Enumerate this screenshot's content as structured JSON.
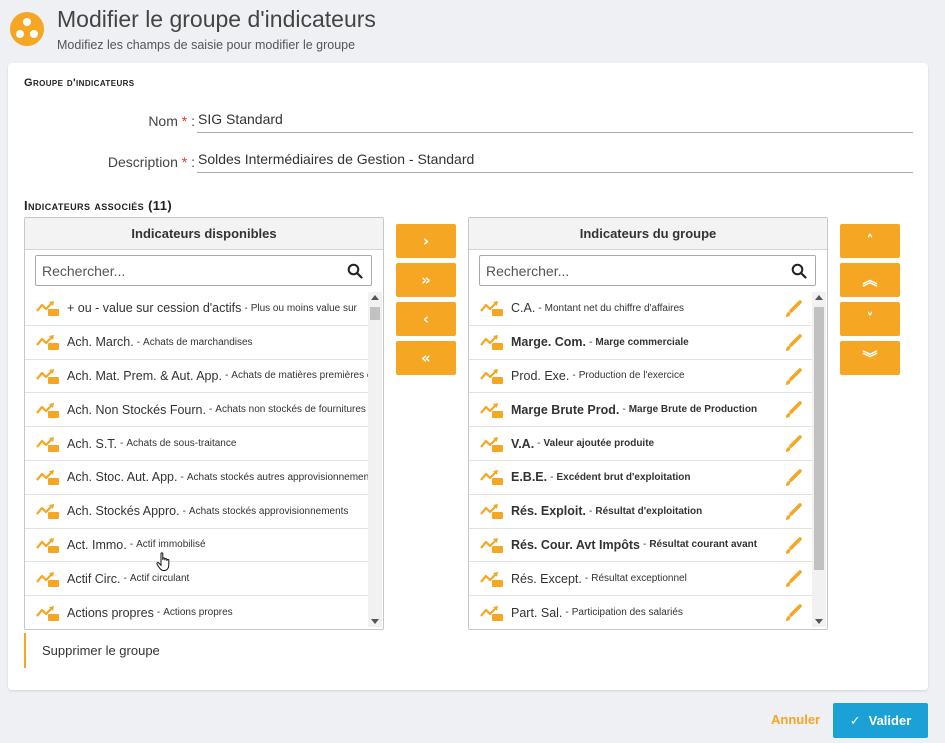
{
  "header": {
    "title": "Modifier le groupe d'indicateurs",
    "subtitle": "Modifiez les champs de saisie pour modifier le groupe",
    "logo_icon": "group-logo-icon"
  },
  "form": {
    "section_title": "Groupe d'indicateurs",
    "name_label": "Nom",
    "name_value": "SIG Standard",
    "description_label": "Description",
    "description_value": "Soldes Intermédiaires de Gestion - Standard",
    "required_mark": "*",
    "label_suffix": ":"
  },
  "associated": {
    "section_title": "Indicateurs associés (11)"
  },
  "available": {
    "header": "Indicateurs disponibles",
    "search_placeholder": "Rechercher...",
    "scroll_fraction": 0.04,
    "items": [
      {
        "code": "+ ou - value sur cession d'actifs",
        "desc": "Plus ou moins value sur"
      },
      {
        "code": "Ach. March.",
        "desc": "Achats de marchandises"
      },
      {
        "code": "Ach. Mat. Prem. & Aut. App.",
        "desc": "Achats de matières premières et"
      },
      {
        "code": "Ach. Non Stockés Fourn.",
        "desc": "Achats non stockés de fournitures"
      },
      {
        "code": "Ach. S.T.",
        "desc": "Achats de sous-traitance"
      },
      {
        "code": "Ach. Stoc. Aut. App.",
        "desc": "Achats stockés autres approvisionnements"
      },
      {
        "code": "Ach. Stockés Appro.",
        "desc": "Achats stockés approvisionnements"
      },
      {
        "code": "Act. Immo.",
        "desc": "Actif immobilisé"
      },
      {
        "code": "Actif Circ.",
        "desc": "Actif circulant"
      },
      {
        "code": "Actions propres",
        "desc": "Actions propres"
      }
    ]
  },
  "group": {
    "header": "Indicateurs du groupe",
    "search_placeholder": "Rechercher...",
    "scroll_fraction": 0.84,
    "items": [
      {
        "code": "C.A.",
        "desc": "Montant net du chiffre d'affaires",
        "bold": false
      },
      {
        "code": "Marge. Com.",
        "desc": "Marge commerciale",
        "bold": true
      },
      {
        "code": "Prod. Exe.",
        "desc": "Production de l'exercice",
        "bold": false
      },
      {
        "code": "Marge Brute Prod.",
        "desc": "Marge Brute de Production",
        "bold": true
      },
      {
        "code": "V.A.",
        "desc": "Valeur ajoutée produite",
        "bold": true
      },
      {
        "code": "E.B.E.",
        "desc": "Excédent brut d'exploitation",
        "bold": true
      },
      {
        "code": "Rés. Exploit.",
        "desc": "Résultat d'exploitation",
        "bold": true
      },
      {
        "code": "Rés. Cour. Avt Impôts",
        "desc": "Résultat courant avant",
        "bold": true
      },
      {
        "code": "Rés. Except.",
        "desc": "Résultat exceptionnel",
        "bold": false
      },
      {
        "code": "Part. Sal.",
        "desc": "Participation des salariés",
        "bold": false
      }
    ]
  },
  "transfer_buttons": [
    {
      "name": "move-right-button",
      "glyph": "›"
    },
    {
      "name": "move-all-right-button",
      "glyph": "»"
    },
    {
      "name": "move-left-button",
      "glyph": "‹"
    },
    {
      "name": "move-all-left-button",
      "glyph": "«"
    }
  ],
  "order_buttons": [
    {
      "name": "move-up-button",
      "glyph": "˄"
    },
    {
      "name": "move-top-button",
      "glyph": "︽"
    },
    {
      "name": "move-down-button",
      "glyph": "˅"
    },
    {
      "name": "move-bottom-button",
      "glyph": "︾"
    }
  ],
  "actions": {
    "delete_label": "Supprimer le groupe",
    "cancel_label": "Annuler",
    "submit_label": "Valider"
  },
  "colors": {
    "accent": "#f5a623",
    "primary": "#1ba1d6",
    "required": "#e53935"
  },
  "icons": {
    "item_icon": "indicator-chart-icon",
    "edit_icon": "edit-pencil-icon",
    "search_icon": "search-icon"
  }
}
